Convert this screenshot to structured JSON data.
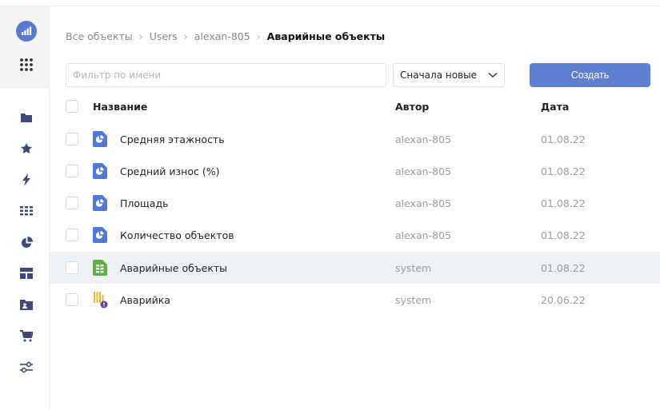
{
  "breadcrumb": {
    "items": [
      "Все объекты",
      "Users",
      "alexan-805"
    ],
    "current": "Аварийные объекты",
    "separator": "›"
  },
  "filter": {
    "placeholder": "Фильтр по имени",
    "value": ""
  },
  "sort": {
    "selected": "Сначала новые"
  },
  "create_button": {
    "label": "Создать"
  },
  "table": {
    "columns": {
      "name": "Название",
      "author": "Автор",
      "date": "Дата"
    },
    "rows": [
      {
        "name": "Средняя этажность",
        "author": "alexan-805",
        "date": "01.08.22",
        "icon": "chart-icon",
        "selected": false
      },
      {
        "name": "Средний износ (%)",
        "author": "alexan-805",
        "date": "01.08.22",
        "icon": "chart-icon",
        "selected": false
      },
      {
        "name": "Площадь",
        "author": "alexan-805",
        "date": "01.08.22",
        "icon": "chart-icon",
        "selected": false
      },
      {
        "name": "Количество объектов",
        "author": "alexan-805",
        "date": "01.08.22",
        "icon": "chart-icon",
        "selected": false
      },
      {
        "name": "Аварийные объекты",
        "author": "system",
        "date": "01.08.22",
        "icon": "dataset-icon",
        "selected": true
      },
      {
        "name": "Аварийка",
        "author": "system",
        "date": "20.06.22",
        "icon": "connection-icon",
        "selected": false
      }
    ]
  },
  "sidebar": {
    "items": [
      "folder-icon",
      "star-icon",
      "lightning-icon",
      "grid-list-icon",
      "pie-chart-icon",
      "dashboard-icon",
      "folder-person-icon",
      "cart-icon",
      "settings-sliders-icon"
    ]
  },
  "colors": {
    "accent": "#5e7fd0",
    "logo": "#5a7ad2",
    "chart_icon": "#4f78d9",
    "dataset_icon": "#5fae46",
    "sidebar_icon": "#3b4a7a",
    "selected_row": "#eef1f6"
  }
}
